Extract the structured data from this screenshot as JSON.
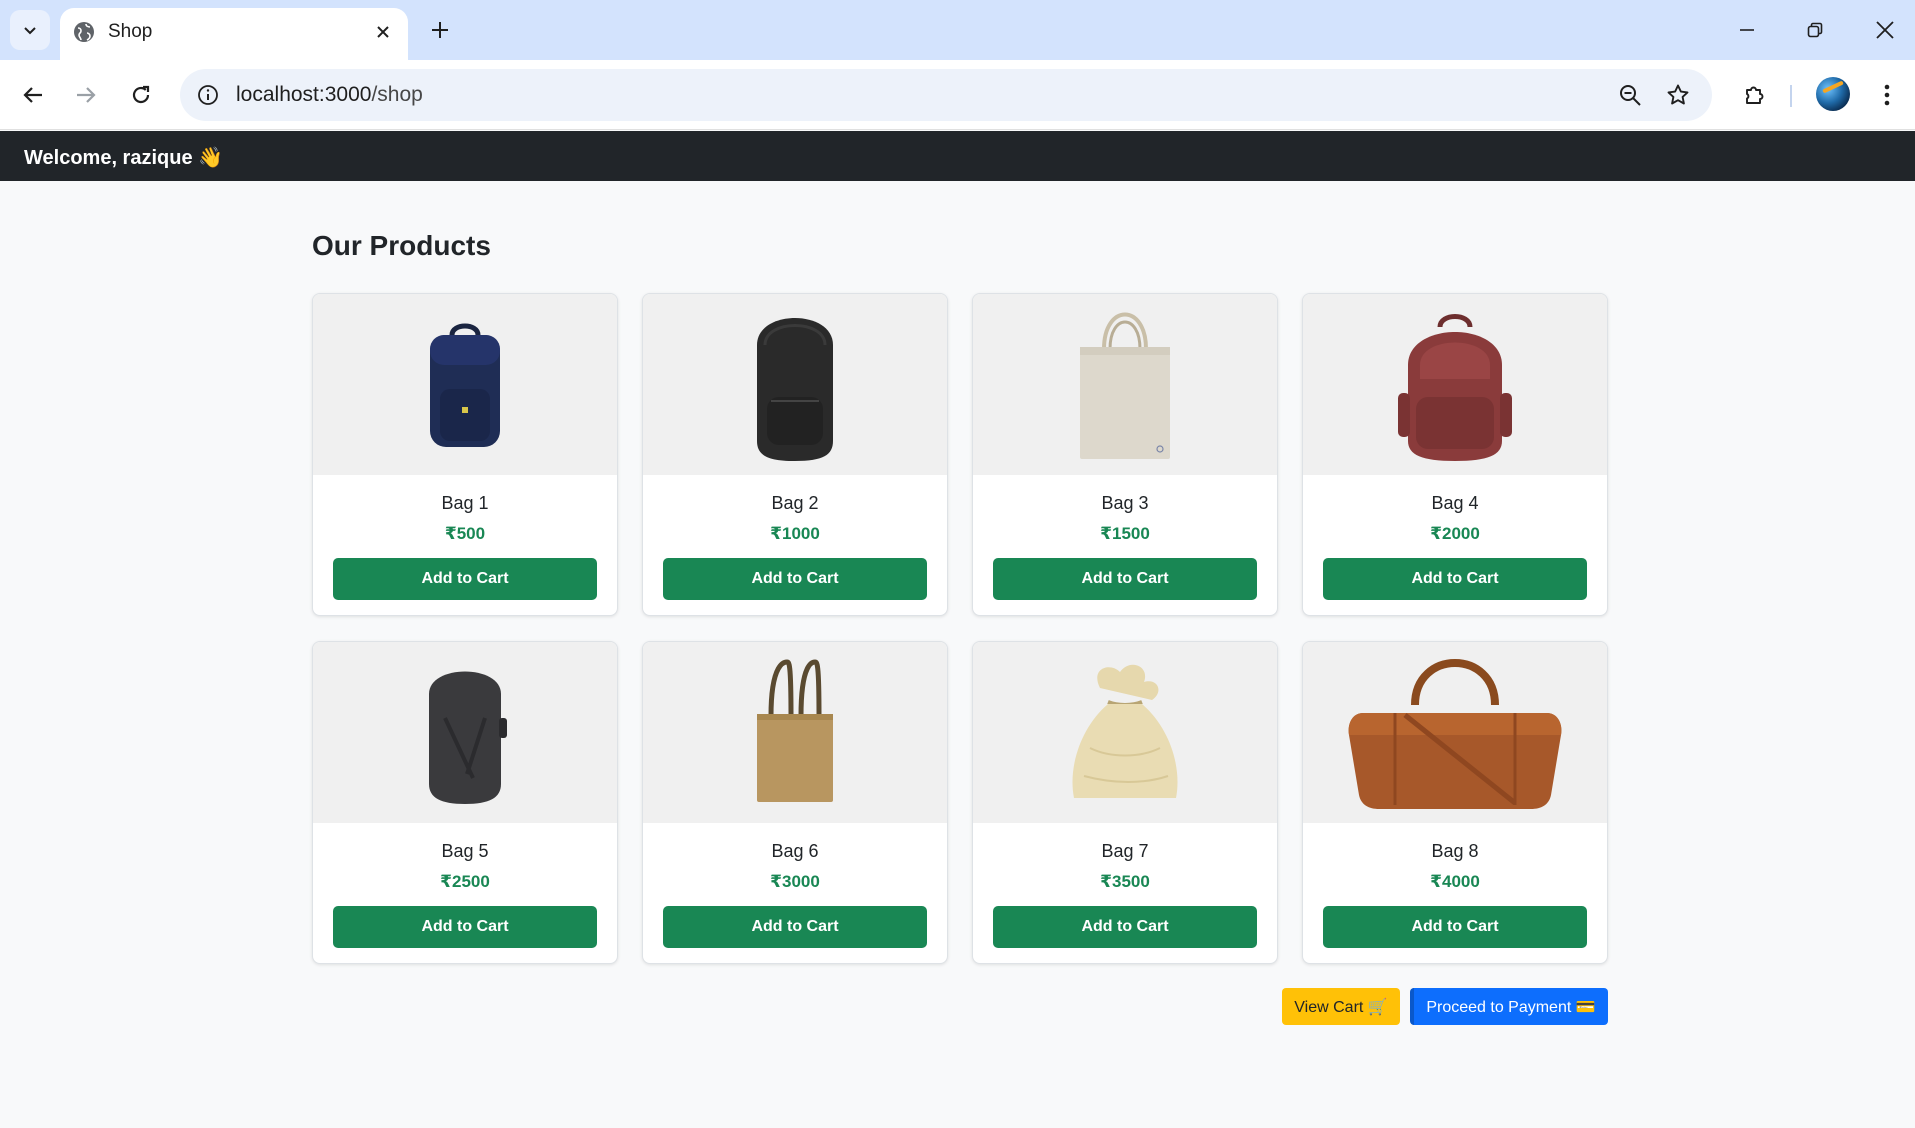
{
  "browser": {
    "tab_title": "Shop",
    "url_host": "localhost:3000",
    "url_path": "/shop"
  },
  "header": {
    "welcome": "Welcome, razique 👋"
  },
  "main": {
    "title": "Our Products",
    "products": [
      {
        "name": "Bag 1",
        "price": "₹500",
        "button": "Add to Cart",
        "icon": "navy-backpack-image"
      },
      {
        "name": "Bag 2",
        "price": "₹1000",
        "button": "Add to Cart",
        "icon": "black-backpack-image"
      },
      {
        "name": "Bag 3",
        "price": "₹1500",
        "button": "Add to Cart",
        "icon": "canvas-tote-image"
      },
      {
        "name": "Bag 4",
        "price": "₹2000",
        "button": "Add to Cart",
        "icon": "leather-backpack-image"
      },
      {
        "name": "Bag 5",
        "price": "₹2500",
        "button": "Add to Cart",
        "icon": "grey-backpack-image"
      },
      {
        "name": "Bag 6",
        "price": "₹3000",
        "button": "Add to Cart",
        "icon": "jute-tote-image"
      },
      {
        "name": "Bag 7",
        "price": "₹3500",
        "button": "Add to Cart",
        "icon": "drawstring-pouch-image"
      },
      {
        "name": "Bag 8",
        "price": "₹4000",
        "button": "Add to Cart",
        "icon": "duffel-bag-image"
      }
    ],
    "view_cart": "View Cart 🛒",
    "proceed": "Proceed to Payment 💳"
  },
  "colors": {
    "header_bg": "#212529",
    "price": "#198754",
    "add_button": "#198754",
    "view_cart_button": "#ffc107",
    "payment_button": "#0d6efd"
  }
}
